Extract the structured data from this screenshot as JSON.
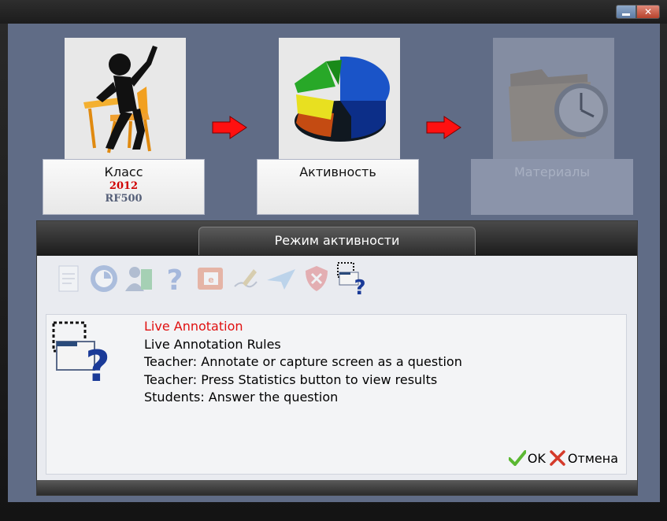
{
  "steps": {
    "class": {
      "label": "Класс",
      "year": "2012",
      "device": "RF500"
    },
    "activity": {
      "label": "Активность"
    },
    "materials": {
      "label": "Материалы"
    }
  },
  "panel": {
    "title": "Режим активности",
    "tools": [
      "notes-icon",
      "clock-quiz-icon",
      "user-book-icon",
      "question-mark-icon",
      "presentation-icon",
      "handwriting-icon",
      "paper-plane-icon",
      "shield-x-icon",
      "live-annotation-icon"
    ],
    "description": {
      "title": "Live Annotation",
      "lines": [
        "Live Annotation Rules",
        "Teacher: Annotate or capture screen as a question",
        "Teacher: Press Statistics button to view results",
        "Students: Answer the question"
      ]
    },
    "ok_label": "OK",
    "cancel_label": "Отмена"
  },
  "colors": {
    "accent_red": "#e01010",
    "background": "#606c86",
    "ok_green": "#5bb832",
    "cancel_red": "#d43a2a"
  }
}
